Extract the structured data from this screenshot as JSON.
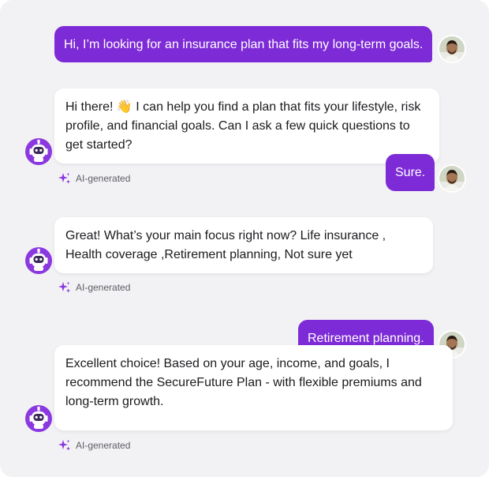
{
  "colors": {
    "accent": "#7d2bd6",
    "bot_bubble": "#ffffff",
    "panel": "#f2f2f4"
  },
  "messages": [
    {
      "role": "user",
      "text": "Hi, I’m looking for an insurance plan that fits my long-term goals."
    },
    {
      "role": "bot",
      "text": "Hi there! 👋 I can help you find a plan that fits your lifestyle, risk profile, and financial goals. Can I ask a few quick questions to get started?",
      "tag": "AI-generated"
    },
    {
      "role": "user",
      "text": "Sure."
    },
    {
      "role": "bot",
      "text": "Great! What’s your main focus right now? Life insurance , Health coverage ,Retirement planning, Not sure yet",
      "tag": "AI-generated"
    },
    {
      "role": "user",
      "text": "Retirement planning."
    },
    {
      "role": "bot",
      "text": "Excellent choice! Based on your age, income, and goals, I recommend the SecureFuture Plan - with flexible premiums and long-term growth.",
      "tag": "AI-generated"
    }
  ],
  "icons": {
    "user_avatar": "user-avatar-photo",
    "bot_avatar": "robot-icon",
    "ai_tag": "sparkle-icon"
  }
}
